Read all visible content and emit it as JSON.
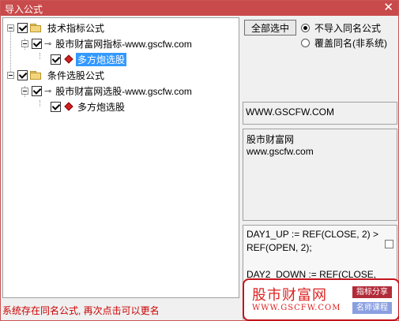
{
  "window": {
    "title": "导入公式",
    "close_glyph": "✕"
  },
  "tree": {
    "groups": [
      {
        "label": "技术指标公式",
        "checked": true,
        "child": {
          "label": "股市财富网指标-www.gscfw.com",
          "checked": true,
          "leaf": {
            "label": "多方炮选股",
            "checked": true,
            "selected": true
          }
        }
      },
      {
        "label": "条件选股公式",
        "checked": true,
        "child": {
          "label": "股市财富网选股-www.gscfw.com",
          "checked": true,
          "leaf": {
            "label": "多方炮选股",
            "checked": true,
            "selected": false
          }
        }
      }
    ]
  },
  "buttons": {
    "select_all": "全部选中"
  },
  "options": {
    "no_import_same": {
      "label": "不导入同名公式",
      "selected": true
    },
    "overwrite_same": {
      "label": "覆盖同名(非系统)",
      "selected": false
    }
  },
  "info": {
    "url": "WWW.GSCFW.COM",
    "description_line1": "股市财富网",
    "description_line2": "www.gscfw.com"
  },
  "code": {
    "text": "DAY1_UP := REF(CLOSE, 2) >\nREF(OPEN, 2);\n\nDAY2_DOWN := REF(CLOSE,"
  },
  "status": "系统存在同名公式, 再次点击可以更名",
  "watermark": {
    "title": "股市财富网",
    "url": "WWW.GSCFW.COM",
    "tag1": "指标分享",
    "tag2": "名师课程"
  },
  "colors": {
    "titlebar": "#c94a4a",
    "selection": "#3399ff",
    "status_text": "#cc0000",
    "watermark_red": "#d22222"
  }
}
